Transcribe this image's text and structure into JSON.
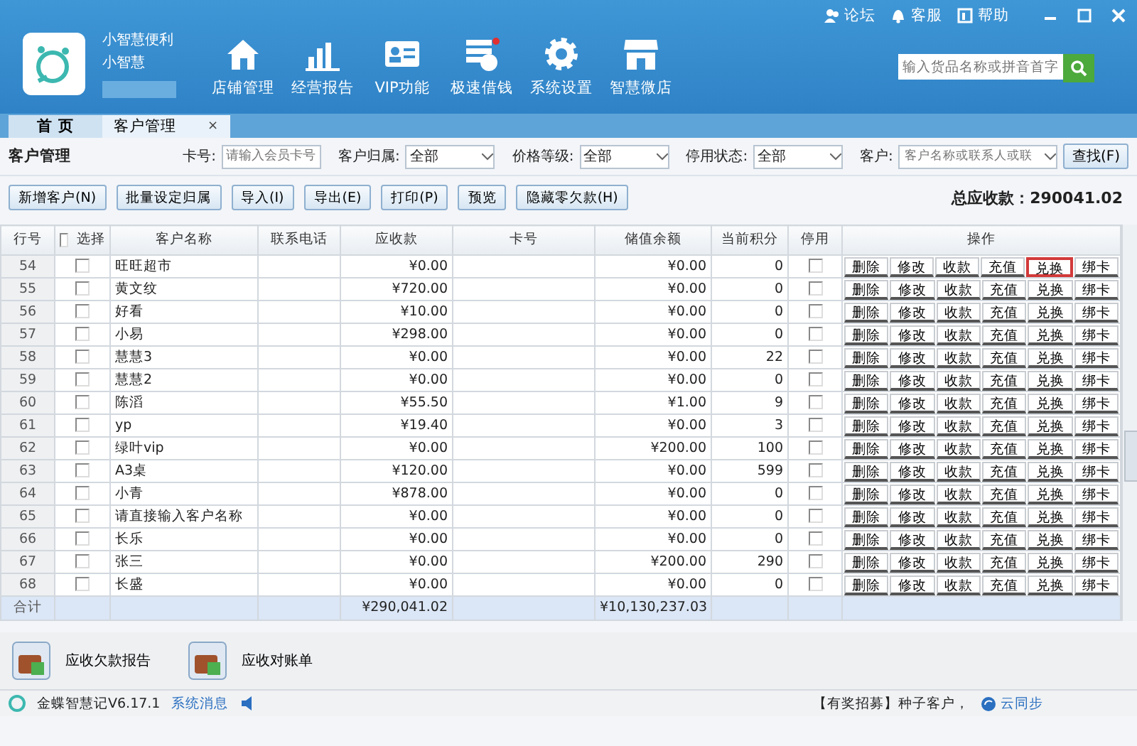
{
  "header": {
    "store_name": "小智慧便利",
    "user": "小智慧",
    "links": [
      {
        "label": "论坛",
        "kind": "users"
      },
      {
        "label": "客服",
        "kind": "bell"
      },
      {
        "label": "帮助",
        "kind": "book"
      }
    ],
    "nav": [
      {
        "label": "店铺管理",
        "kind": "home"
      },
      {
        "label": "经营报告",
        "kind": "bars"
      },
      {
        "label": "VIP功能",
        "kind": "card"
      },
      {
        "label": "极速借钱",
        "kind": "coin"
      },
      {
        "label": "系统设置",
        "kind": "gear"
      },
      {
        "label": "智慧微店",
        "kind": "shop"
      }
    ],
    "search": {
      "placeholder": "输入货品名称或拼音首字"
    }
  },
  "tabs": [
    {
      "label": "首 页",
      "selected": false
    },
    {
      "label": "客户管理",
      "selected": true,
      "close": "×"
    }
  ],
  "filter": {
    "title": "客户管理",
    "fields": [
      {
        "label": "卡号:",
        "kind": "input",
        "placeholder": "请输入会员卡号"
      },
      {
        "label": "客户归属:",
        "kind": "select",
        "value": "全部"
      },
      {
        "label": "价格等级:",
        "kind": "select",
        "value": "全部"
      },
      {
        "label": "停用状态:",
        "kind": "select",
        "value": "全部"
      },
      {
        "label": "客户:",
        "kind": "combo",
        "placeholder": "客户名称或联系人或联"
      }
    ],
    "search_button": "查找(F)"
  },
  "toolbar": {
    "buttons": [
      "新增客户(N)",
      "批量设定归属",
      "导入(I)",
      "导出(E)",
      "打印(P)",
      "预览",
      "隐藏零欠款(H)"
    ],
    "total": "总应收款：290041.02"
  },
  "table": {
    "columns": [
      "行号",
      "选择",
      "客户名称",
      "联系电话",
      "应收款",
      "卡号",
      "储值余额",
      "当前积分",
      "停用",
      "操作"
    ],
    "select_all_checked": false,
    "rows": [
      {
        "no": "54",
        "checked": false,
        "name": "旺旺超市",
        "receivable": "¥0.00",
        "balance": "¥0.00",
        "points": "0",
        "disabled": false,
        "actions": [
          {
            "label": "删除",
            "highlighted": false
          },
          {
            "label": "修改",
            "highlighted": false
          },
          {
            "label": "收款",
            "highlighted": false
          },
          {
            "label": "充值",
            "highlighted": false
          },
          {
            "label": "兑换",
            "highlighted": true
          },
          {
            "label": "绑卡",
            "highlighted": false
          }
        ]
      },
      {
        "no": "55",
        "checked": false,
        "name": "黄文纹",
        "receivable": "¥720.00",
        "balance": "¥0.00",
        "points": "0",
        "disabled": false,
        "actions": [
          {
            "label": "删除",
            "highlighted": false
          },
          {
            "label": "修改",
            "highlighted": false
          },
          {
            "label": "收款",
            "highlighted": false
          },
          {
            "label": "充值",
            "highlighted": false
          },
          {
            "label": "兑换",
            "highlighted": false
          },
          {
            "label": "绑卡",
            "highlighted": false
          }
        ]
      },
      {
        "no": "56",
        "checked": false,
        "name": "好看",
        "receivable": "¥10.00",
        "balance": "¥0.00",
        "points": "0",
        "disabled": false,
        "actions": [
          {
            "label": "删除",
            "highlighted": false
          },
          {
            "label": "修改",
            "highlighted": false
          },
          {
            "label": "收款",
            "highlighted": false
          },
          {
            "label": "充值",
            "highlighted": false
          },
          {
            "label": "兑换",
            "highlighted": false
          },
          {
            "label": "绑卡",
            "highlighted": false
          }
        ]
      },
      {
        "no": "57",
        "checked": false,
        "name": "小易",
        "receivable": "¥298.00",
        "balance": "¥0.00",
        "points": "0",
        "disabled": false,
        "actions": [
          {
            "label": "删除",
            "highlighted": false
          },
          {
            "label": "修改",
            "highlighted": false
          },
          {
            "label": "收款",
            "highlighted": false
          },
          {
            "label": "充值",
            "highlighted": false
          },
          {
            "label": "兑换",
            "highlighted": false
          },
          {
            "label": "绑卡",
            "highlighted": false
          }
        ]
      },
      {
        "no": "58",
        "checked": false,
        "name": "慧慧3",
        "receivable": "¥0.00",
        "balance": "¥0.00",
        "points": "22",
        "disabled": false,
        "actions": [
          {
            "label": "删除",
            "highlighted": false
          },
          {
            "label": "修改",
            "highlighted": false
          },
          {
            "label": "收款",
            "highlighted": false
          },
          {
            "label": "充值",
            "highlighted": false
          },
          {
            "label": "兑换",
            "highlighted": false
          },
          {
            "label": "绑卡",
            "highlighted": false
          }
        ]
      },
      {
        "no": "59",
        "checked": false,
        "name": "慧慧2",
        "receivable": "¥0.00",
        "balance": "¥0.00",
        "points": "0",
        "disabled": false,
        "actions": [
          {
            "label": "删除",
            "highlighted": false
          },
          {
            "label": "修改",
            "highlighted": false
          },
          {
            "label": "收款",
            "highlighted": false
          },
          {
            "label": "充值",
            "highlighted": false
          },
          {
            "label": "兑换",
            "highlighted": false
          },
          {
            "label": "绑卡",
            "highlighted": false
          }
        ]
      },
      {
        "no": "60",
        "checked": false,
        "name": "陈滔",
        "receivable": "¥55.50",
        "balance": "¥1.00",
        "points": "9",
        "disabled": false,
        "actions": [
          {
            "label": "删除",
            "highlighted": false
          },
          {
            "label": "修改",
            "highlighted": false
          },
          {
            "label": "收款",
            "highlighted": false
          },
          {
            "label": "充值",
            "highlighted": false
          },
          {
            "label": "兑换",
            "highlighted": false
          },
          {
            "label": "绑卡",
            "highlighted": false
          }
        ]
      },
      {
        "no": "61",
        "checked": false,
        "name": "yp",
        "receivable": "¥19.40",
        "balance": "¥0.00",
        "points": "3",
        "disabled": false,
        "actions": [
          {
            "label": "删除",
            "highlighted": false
          },
          {
            "label": "修改",
            "highlighted": false
          },
          {
            "label": "收款",
            "highlighted": false
          },
          {
            "label": "充值",
            "highlighted": false
          },
          {
            "label": "兑换",
            "highlighted": false
          },
          {
            "label": "绑卡",
            "highlighted": false
          }
        ]
      },
      {
        "no": "62",
        "checked": false,
        "name": "绿叶vip",
        "receivable": "¥0.00",
        "balance": "¥200.00",
        "points": "100",
        "disabled": false,
        "actions": [
          {
            "label": "删除",
            "highlighted": false
          },
          {
            "label": "修改",
            "highlighted": false
          },
          {
            "label": "收款",
            "highlighted": false
          },
          {
            "label": "充值",
            "highlighted": false
          },
          {
            "label": "兑换",
            "highlighted": false
          },
          {
            "label": "绑卡",
            "highlighted": false
          }
        ]
      },
      {
        "no": "63",
        "checked": false,
        "name": "A3桌",
        "receivable": "¥120.00",
        "balance": "¥0.00",
        "points": "599",
        "disabled": false,
        "actions": [
          {
            "label": "删除",
            "highlighted": false
          },
          {
            "label": "修改",
            "highlighted": false
          },
          {
            "label": "收款",
            "highlighted": false
          },
          {
            "label": "充值",
            "highlighted": false
          },
          {
            "label": "兑换",
            "highlighted": false
          },
          {
            "label": "绑卡",
            "highlighted": false
          }
        ]
      },
      {
        "no": "64",
        "checked": false,
        "name": "小青",
        "receivable": "¥878.00",
        "balance": "¥0.00",
        "points": "0",
        "disabled": false,
        "actions": [
          {
            "label": "删除",
            "highlighted": false
          },
          {
            "label": "修改",
            "highlighted": false
          },
          {
            "label": "收款",
            "highlighted": false
          },
          {
            "label": "充值",
            "highlighted": false
          },
          {
            "label": "兑换",
            "highlighted": false
          },
          {
            "label": "绑卡",
            "highlighted": false
          }
        ]
      },
      {
        "no": "65",
        "checked": false,
        "name": "请直接输入客户名称",
        "receivable": "¥0.00",
        "balance": "¥0.00",
        "points": "0",
        "disabled": false,
        "actions": [
          {
            "label": "删除",
            "highlighted": false
          },
          {
            "label": "修改",
            "highlighted": false
          },
          {
            "label": "收款",
            "highlighted": false
          },
          {
            "label": "充值",
            "highlighted": false
          },
          {
            "label": "兑换",
            "highlighted": false
          },
          {
            "label": "绑卡",
            "highlighted": false
          }
        ]
      },
      {
        "no": "66",
        "checked": false,
        "name": "长乐",
        "receivable": "¥0.00",
        "balance": "¥0.00",
        "points": "0",
        "disabled": false,
        "actions": [
          {
            "label": "删除",
            "highlighted": false
          },
          {
            "label": "修改",
            "highlighted": false
          },
          {
            "label": "收款",
            "highlighted": false
          },
          {
            "label": "充值",
            "highlighted": false
          },
          {
            "label": "兑换",
            "highlighted": false
          },
          {
            "label": "绑卡",
            "highlighted": false
          }
        ]
      },
      {
        "no": "67",
        "checked": false,
        "name": "张三",
        "receivable": "¥0.00",
        "balance": "¥200.00",
        "points": "290",
        "disabled": false,
        "actions": [
          {
            "label": "删除",
            "highlighted": false
          },
          {
            "label": "修改",
            "highlighted": false
          },
          {
            "label": "收款",
            "highlighted": false
          },
          {
            "label": "充值",
            "highlighted": false
          },
          {
            "label": "兑换",
            "highlighted": false
          },
          {
            "label": "绑卡",
            "highlighted": false
          }
        ]
      },
      {
        "no": "68",
        "checked": false,
        "name": "长盛",
        "receivable": "¥0.00",
        "balance": "¥0.00",
        "points": "0",
        "disabled": false,
        "actions": [
          {
            "label": "删除",
            "highlighted": false
          },
          {
            "label": "修改",
            "highlighted": false
          },
          {
            "label": "收款",
            "highlighted": false
          },
          {
            "label": "充值",
            "highlighted": false
          },
          {
            "label": "兑换",
            "highlighted": false
          },
          {
            "label": "绑卡",
            "highlighted": false
          }
        ]
      }
    ],
    "total": {
      "label": "合计",
      "receivable": "¥290,041.02",
      "balance": "¥10,130,237.03"
    }
  },
  "reports": [
    {
      "label": "应收欠款报告"
    },
    {
      "label": "应收对账单"
    }
  ],
  "status_bar": {
    "version": "金蝶智慧记V6.17.1",
    "messages": "系统消息",
    "promo": "【有奖招募】种子客户，",
    "sync": "云同步"
  }
}
